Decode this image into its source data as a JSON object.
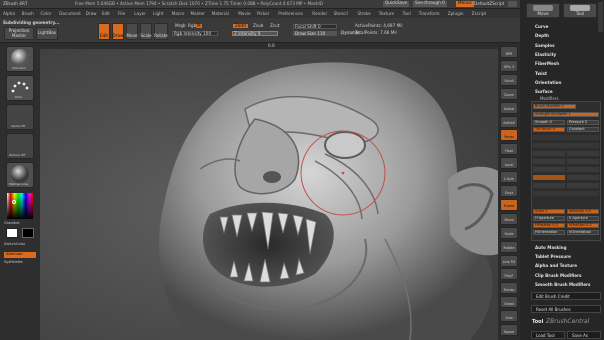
{
  "titlebar": {
    "app": "ZBrush 4R7",
    "status": "Free Mem 5.046GB • Active Mem 1794 • Scratch Disk 1070 • ZTime 1.75 Timer 0.088 • PolyCount 4.673 MP • MeshID",
    "quicksave": "QuickSave",
    "see_through": "See-through  0",
    "menus": "Menus",
    "default_script": "DefaultZScript"
  },
  "menubar": [
    "Alpha",
    "Brush",
    "Color",
    "Document",
    "Draw",
    "Edit",
    "File",
    "Layer",
    "Light",
    "Macro",
    "Marker",
    "Material",
    "Movie",
    "Picker",
    "Preferences",
    "Render",
    "Stencil",
    "Stroke",
    "Texture",
    "Tool",
    "Transform",
    "Zplugin",
    "Zscript"
  ],
  "shelf": {
    "status": "Subdividing geometry...",
    "projection": "Projection",
    "projection2": "Master",
    "lightbox": "LightBox",
    "edit": "Edit",
    "draw": "Draw",
    "move": "Move",
    "scale": "Scale",
    "rotate": "Rotate",
    "mrgb": "Mrgb",
    "rgb": "Rgb",
    "m": "M",
    "rgb_intensity": "Rgb Intensity 100",
    "zadd": "Zadd",
    "zsub": "Zsub",
    "zcut": "Zcut",
    "z_intensity": "Z Intensity 9",
    "focal_shift": "Focal Shift 0",
    "draw_size": "Draw Size 110",
    "dynamic": "Dynamic",
    "active_points": "ActivePoints: 4,697 Mil",
    "total_points": "TotalPoints: 7.66 Mil"
  },
  "ruler": "0.0",
  "left": {
    "tile1": "Standard",
    "tile2": "Dots",
    "tile3": "Alpha Off",
    "tile4": "Texture Off",
    "tile5": "MatCap Gray",
    "gradient": "Gradient",
    "switch": "SwitchColor",
    "alternate": "Alternate",
    "sys_palette": "SysPalette"
  },
  "right_tools": [
    "BPR",
    "SPix 3",
    "Scroll",
    "Zoom",
    "Actual",
    "AAHalf",
    "Persp",
    "Floor",
    "Local",
    "L.Sym",
    "Gxyz",
    "Frame",
    "Move",
    "Scale",
    "Rotate",
    "Line Fill",
    "PolyF",
    "Transp",
    "Ghost",
    "Solo",
    "Xpose"
  ],
  "tray": {
    "top_buttons": [
      "Move",
      "Tool"
    ],
    "items": [
      "Curve",
      "Depth",
      "Samples",
      "Elasticity",
      "FiberMesh",
      "Twist",
      "Orientation",
      "Surface",
      "Modifiers"
    ],
    "brush_modifier": "Brush Modifier 0",
    "strength_multiplier": "Strength Multiplier 1",
    "smooth": "Smooth 0",
    "pressure": "Pressure 0",
    "tilt_brush": "Tilt Brush 0",
    "constant": "Constant",
    "scale": "Scale 1",
    "intensity": "Intensity 0.9",
    "h_aperture": "H Aperture",
    "v_aperture": "V Aperture",
    "h_position": "HPosition 0.2",
    "v_position": "VPosition 0.2",
    "h_orientation": "HOrientation",
    "v_orientation": "VOrientation",
    "sections": [
      "Auto Masking",
      "Tablet Pressure",
      "Alpha and Texture",
      "Clip Brush Modifiers",
      "Smooth Brush Modifiers"
    ],
    "edit_brush_credit": "Edit Brush Credit",
    "reset_all_brushes": "Reset All Brushes",
    "tool": "Tool",
    "load_tool": "Load Tool",
    "save_as": "Save As"
  },
  "watermark": "ZBrushCentral"
}
